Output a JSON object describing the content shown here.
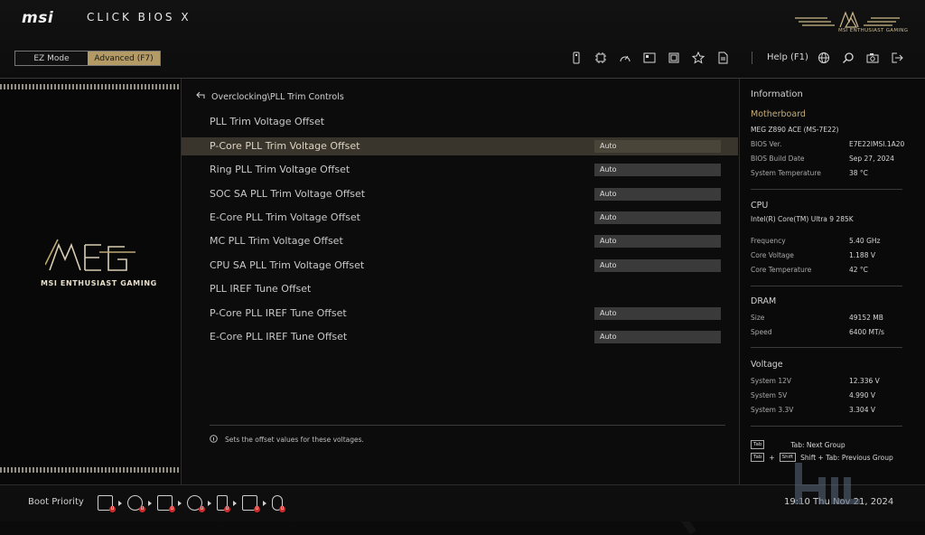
{
  "header": {
    "brand": "msi",
    "app_title": "CLICK BIOS X",
    "mode_ez": "EZ Mode",
    "mode_advanced": "Advanced (F7)",
    "help": "Help (F1)",
    "meg_caption": "MSI ENTHUSIAST GAMING",
    "toolbar_icons": [
      "usb-icon",
      "cpu-icon",
      "gauge-icon",
      "board-icon",
      "memory-icon",
      "star-icon",
      "document-icon"
    ],
    "right_icons": [
      "globe-icon",
      "search-icon",
      "camera-icon",
      "exit-icon"
    ]
  },
  "left_panel": {
    "brand_caption": "MSI ENTHUSIAST GAMING"
  },
  "main": {
    "breadcrumb": "Overclocking\\PLL Trim Controls",
    "settings": [
      {
        "label": "PLL Trim Voltage Offset",
        "value": null,
        "selected": false
      },
      {
        "label": "P-Core PLL Trim Voltage Offset",
        "value": "Auto",
        "selected": true
      },
      {
        "label": "Ring PLL Trim Voltage Offset",
        "value": "Auto",
        "selected": false
      },
      {
        "label": "SOC SA PLL Trim Voltage Offset",
        "value": "Auto",
        "selected": false
      },
      {
        "label": "E-Core PLL Trim Voltage Offset",
        "value": "Auto",
        "selected": false
      },
      {
        "label": "MC PLL Trim Voltage Offset",
        "value": "Auto",
        "selected": false
      },
      {
        "label": "CPU SA PLL Trim Voltage Offset",
        "value": "Auto",
        "selected": false
      },
      {
        "label": "PLL IREF Tune Offset",
        "value": null,
        "selected": false
      },
      {
        "label": "P-Core PLL IREF Tune Offset",
        "value": "Auto",
        "selected": false
      },
      {
        "label": "E-Core PLL IREF Tune Offset",
        "value": "Auto",
        "selected": false
      }
    ],
    "help_text": "Sets the offset values for these voltages."
  },
  "info": {
    "title": "Information",
    "motherboard": {
      "heading": "Motherboard",
      "model": "MEG Z890 ACE (MS-7E22)",
      "bios_ver_label": "BIOS Ver.",
      "bios_ver": "E7E22IMSI.1A20",
      "bios_date_label": "BIOS Build Date",
      "bios_date": "Sep 27, 2024",
      "sys_temp_label": "System Temperature",
      "sys_temp": "38 °C"
    },
    "cpu": {
      "heading": "CPU",
      "model": "Intel(R) Core(TM) Ultra 9 285K",
      "freq_label": "Frequency",
      "freq": "5.40 GHz",
      "volt_label": "Core Voltage",
      "volt": "1.188 V",
      "temp_label": "Core Temperature",
      "temp": "42 °C"
    },
    "dram": {
      "heading": "DRAM",
      "size_label": "Size",
      "size": "49152 MB",
      "speed_label": "Speed",
      "speed": "6400 MT/s"
    },
    "voltage": {
      "heading": "Voltage",
      "v12_label": "System 12V",
      "v12": "12.336 V",
      "v5_label": "System 5V",
      "v5": "4.990 V",
      "v33_label": "System 3.3V",
      "v33": "3.304 V"
    },
    "keys": {
      "tab_key": "Tab",
      "tab_text": "Tab: Next Group",
      "shift_key": "Shift",
      "shift_tab_text": "Shift + Tab: Previous Group"
    }
  },
  "footer": {
    "boot_priority": "Boot Priority",
    "datetime": "19:10  Thu Nov 21, 2024"
  },
  "colors": {
    "accent_gold": "#c9ae74",
    "selected_row": "#39352d",
    "value_box": "#3a3a3a"
  }
}
